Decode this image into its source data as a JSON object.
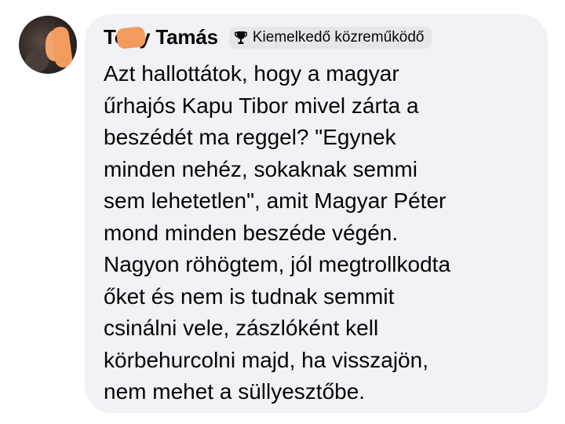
{
  "comment": {
    "author": "Toby Tamás",
    "badge": {
      "icon": "trophy-icon",
      "label": "Kiemelkedő közreműködő"
    },
    "lines": [
      "Azt hallottátok, hogy a magyar",
      "űrhajós Kapu Tibor mivel zárta a",
      "beszédét ma reggel? \"Egynek",
      "minden nehéz, sokaknak semmi",
      "sem lehetetlen\", amit Magyar Péter",
      "mond minden beszéde végén.",
      "Nagyon röhögtem, jól megtrollkodta",
      "őket és nem is tudnak semmit",
      "csinálni vele, zászlóként kell",
      "körbehurcolni majd, ha visszajön,",
      "nem mehet a süllyesztőbe."
    ]
  },
  "colors": {
    "bubble_background": "#f0f2f5",
    "badge_background": "#e4e6eb",
    "text": "#050505",
    "redaction": "#f39a5d"
  }
}
